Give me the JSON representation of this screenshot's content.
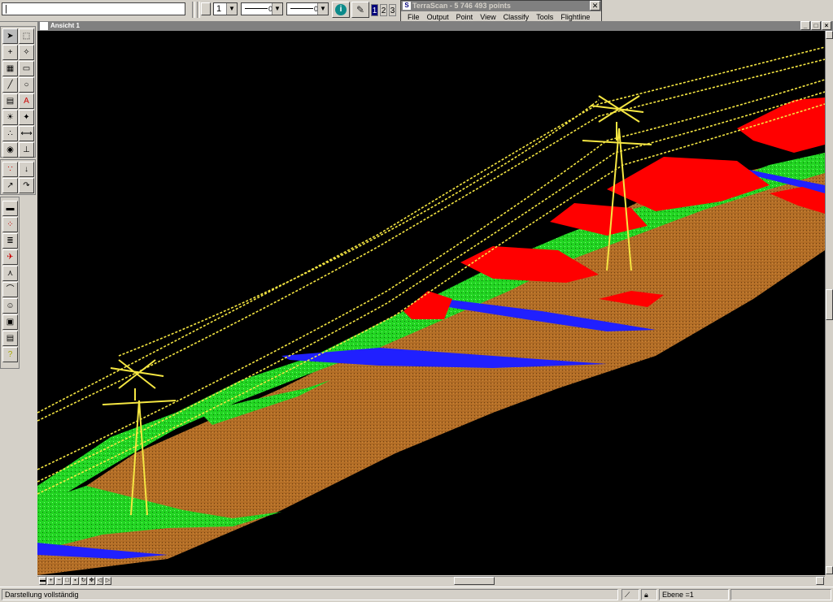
{
  "command_input": "|",
  "toolbar": {
    "color_value": "",
    "weight_value": "1",
    "style_value": "0",
    "line_value": "0",
    "view_buttons": [
      "1",
      "2",
      "3"
    ]
  },
  "terrascan": {
    "title": "TerraScan - 5 746 493 points",
    "close": "✕",
    "menu": [
      "File",
      "Output",
      "Point",
      "View",
      "Classify",
      "Tools",
      "Flightline"
    ]
  },
  "view": {
    "title": "Ansicht 1",
    "icon": "view-icon"
  },
  "status": {
    "message": "Darstellung vollständig",
    "level": "Ebene =1"
  },
  "colors": {
    "background": "#000000",
    "ground": "#b26d26",
    "vegetation": "#22d422",
    "building": "#ff0000",
    "water": "#2020ff",
    "wire": "#f5e642",
    "window_bg": "#d4d0c8"
  }
}
